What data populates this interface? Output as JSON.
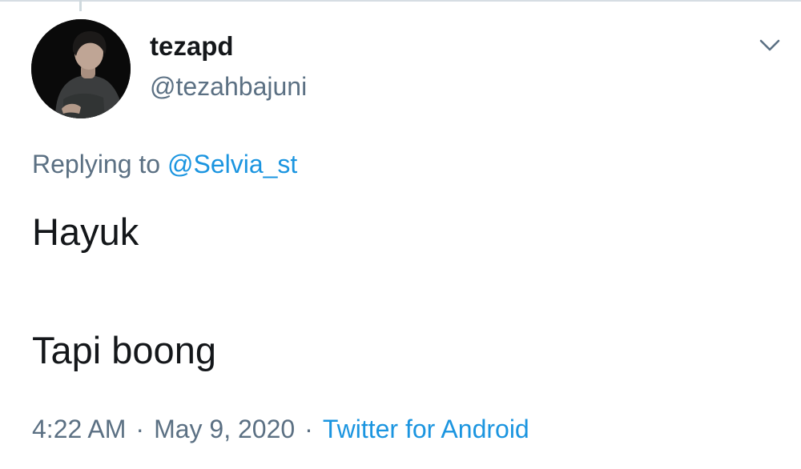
{
  "tweet": {
    "author": {
      "display_name": "tezapd",
      "handle": "@tezahbajuni"
    },
    "reply_prefix": "Replying to",
    "reply_to": "@Selvia_st",
    "text_lines": [
      "Hayuk",
      "Tapi boong"
    ],
    "time": "4:22 AM",
    "separator": "·",
    "date": "May 9, 2020",
    "source": "Twitter for Android"
  },
  "icons": {
    "menu": "chevron-down-icon",
    "avatar": "user-avatar"
  },
  "colors": {
    "text_primary": "#14171a",
    "text_secondary": "#5b7083",
    "link": "#1b95e0",
    "background": "#ffffff"
  }
}
